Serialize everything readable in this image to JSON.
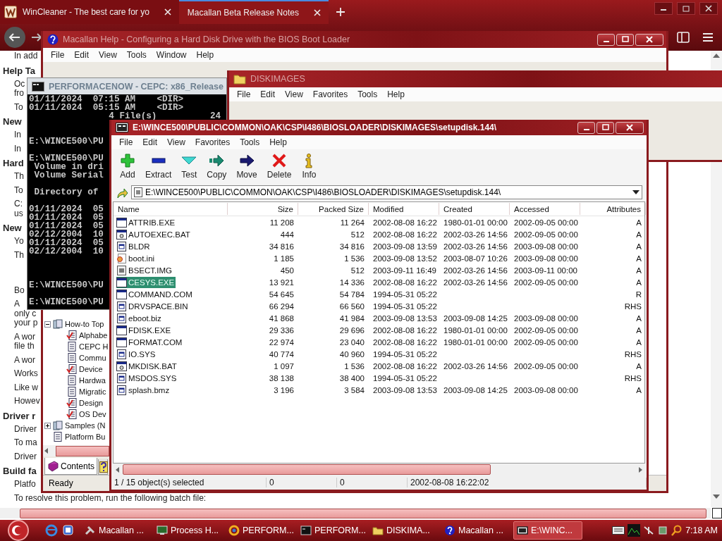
{
  "browser": {
    "tabs": [
      {
        "title": "WinCleaner - The best care for yo",
        "selected": false
      },
      {
        "title": "Macallan Beta Release Notes",
        "selected": true
      }
    ],
    "article_top": [
      {
        "kind": "para",
        "lines": [
          "In add"
        ]
      },
      {
        "kind": "heading",
        "lines": [
          "Help Ta"
        ]
      },
      {
        "kind": "para",
        "lines": [
          "Oc",
          "fro"
        ]
      },
      {
        "kind": "para",
        "lines": [
          "To"
        ]
      },
      {
        "kind": "heading",
        "lines": [
          "New"
        ]
      },
      {
        "kind": "para",
        "lines": [
          "In"
        ]
      },
      {
        "kind": "para",
        "lines": [
          "In"
        ]
      },
      {
        "kind": "heading",
        "lines": [
          "Hard"
        ]
      },
      {
        "kind": "para",
        "lines": [
          "Th"
        ]
      },
      {
        "kind": "para",
        "lines": [
          "To"
        ]
      },
      {
        "kind": "para",
        "lines": [
          "C:",
          "us"
        ]
      },
      {
        "kind": "heading",
        "lines": [
          "New"
        ]
      },
      {
        "kind": "para",
        "lines": [
          "Yo"
        ]
      },
      {
        "kind": "para",
        "lines": [
          "Th"
        ]
      }
    ],
    "article_bottom": [
      {
        "kind": "para",
        "lines": [
          "Bo"
        ]
      },
      {
        "kind": "para",
        "lines": [
          "A",
          "only c",
          "your p"
        ]
      },
      {
        "kind": "para",
        "lines": [
          "A wor",
          "file th"
        ]
      },
      {
        "kind": "para",
        "lines": [
          "A wor"
        ]
      },
      {
        "kind": "para",
        "lines": [
          "Works"
        ]
      },
      {
        "kind": "para",
        "lines": [
          "Like w"
        ]
      },
      {
        "kind": "para",
        "lines": [
          "Howev"
        ]
      },
      {
        "kind": "heading",
        "lines": [
          "Driver r"
        ]
      },
      {
        "kind": "para",
        "lines": [
          "Driver"
        ]
      },
      {
        "kind": "para",
        "lines": [
          "To ma"
        ]
      },
      {
        "kind": "para",
        "lines": [
          "Driver"
        ]
      },
      {
        "kind": "heading",
        "lines": [
          "Build fa"
        ]
      },
      {
        "kind": "para",
        "lines": [
          "Platfo"
        ]
      },
      {
        "kind": "para",
        "lines": [
          "To resolve this problem, run the following batch file:"
        ]
      }
    ]
  },
  "help_window": {
    "title": "Macallan Help - Configuring a Hard Disk Drive with the BIOS Boot Loader",
    "menu": [
      "File",
      "Edit",
      "View",
      "Tools",
      "Window",
      "Help"
    ],
    "tree": [
      {
        "label": "How-to Top",
        "kind": "book",
        "expanded": true,
        "children": [
          {
            "label": "Alphabe",
            "kind": "checklist"
          },
          {
            "label": "CEPC H",
            "kind": "page"
          },
          {
            "label": "Commu",
            "kind": "page"
          },
          {
            "label": "Device",
            "kind": "checklist"
          },
          {
            "label": "Hardwa",
            "kind": "page"
          },
          {
            "label": "Migratic",
            "kind": "page"
          },
          {
            "label": "Design",
            "kind": "checklist"
          },
          {
            "label": "OS Dev",
            "kind": "checklist"
          }
        ]
      },
      {
        "label": "Samples (N",
        "kind": "book",
        "expanded": false
      },
      {
        "label": "Platform Bu",
        "kind": "page"
      }
    ],
    "tabs": [
      {
        "kind": "contents",
        "label": "Contents",
        "selected": true
      },
      {
        "kind": "index",
        "selected": false
      }
    ],
    "status": "Ready"
  },
  "explorer_window": {
    "title": "DISKIMAGES",
    "menu": [
      "File",
      "Edit",
      "View",
      "Favorites",
      "Tools",
      "Help"
    ]
  },
  "console_window": {
    "title": "PERFORMACENOW - CEPC: x86_Release",
    "output": "01/11/2024  07:15 AM    <DIR>\n01/11/2024  05:15 AM    <DIR>\n               4 File(s)          24\n\n\nE:\\WINCE500\\PU\n\nE:\\WINCE500\\PU\n Volume in dri\n Volume Serial\n\n Directory of\n\n01/11/2024  05\n01/11/2024  05\n01/11/2024  05\n02/12/2004  10\n01/11/2024  05\n02/12/2004  10\n\n\n\nE:\\WINCE500\\PU\n\nE:\\WINCE500\\PU"
  },
  "archive_window": {
    "title": "E:\\WINCE500\\PUBLIC\\COMMON\\OAK\\CSP\\I486\\BIOSLOADER\\DISKIMAGES\\setupdisk.144\\",
    "menu": [
      "File",
      "Edit",
      "View",
      "Favorites",
      "Tools",
      "Help"
    ],
    "toolbar": [
      {
        "label": "Add",
        "kind": "add"
      },
      {
        "label": "Extract",
        "kind": "extract"
      },
      {
        "label": "Test",
        "kind": "test"
      },
      {
        "label": "Copy",
        "kind": "copy"
      },
      {
        "label": "Move",
        "kind": "move"
      },
      {
        "label": "Delete",
        "kind": "delete"
      },
      {
        "label": "Info",
        "kind": "info"
      }
    ],
    "path": "E:\\WINCE500\\PUBLIC\\COMMON\\OAK\\CSP\\I486\\BIOSLOADER\\DISKIMAGES\\setupdisk.144\\",
    "columns": [
      "Name",
      "Size",
      "Packed Size",
      "Modified",
      "Created",
      "Accessed",
      "Attributes"
    ],
    "files": [
      {
        "name": "ATTRIB.EXE",
        "kind": "exe",
        "size": "11 208",
        "packed_size": "11 264",
        "modified": "2002-08-08 16:22",
        "created": "1980-01-01 00:00",
        "accessed": "2002-09-05 00:00",
        "attributes": "A",
        "selected": false
      },
      {
        "name": "AUTOEXEC.BAT",
        "kind": "bat",
        "size": "444",
        "packed_size": "512",
        "modified": "2002-08-08 16:22",
        "created": "2002-03-26 14:56",
        "accessed": "2002-09-05 00:00",
        "attributes": "A",
        "selected": false
      },
      {
        "name": "BLDR",
        "kind": "bin",
        "size": "34 816",
        "packed_size": "34 816",
        "modified": "2003-09-08 13:59",
        "created": "2002-03-26 14:56",
        "accessed": "2003-09-08 00:00",
        "attributes": "A",
        "selected": false
      },
      {
        "name": "boot.ini",
        "kind": "ini",
        "size": "1 185",
        "packed_size": "1 536",
        "modified": "2003-09-08 13:52",
        "created": "2003-08-07 10:26",
        "accessed": "2003-09-08 00:00",
        "attributes": "A",
        "selected": false
      },
      {
        "name": "BSECT.IMG",
        "kind": "img",
        "size": "450",
        "packed_size": "512",
        "modified": "2003-09-11 16:49",
        "created": "2002-03-26 14:56",
        "accessed": "2003-09-11 00:00",
        "attributes": "A",
        "selected": false
      },
      {
        "name": "CESYS.EXE",
        "kind": "exe",
        "size": "13 921",
        "packed_size": "14 336",
        "modified": "2002-08-08 16:22",
        "created": "2002-03-26 14:56",
        "accessed": "2002-09-05 00:00",
        "attributes": "A",
        "selected": true
      },
      {
        "name": "COMMAND.COM",
        "kind": "exe",
        "size": "54 645",
        "packed_size": "54 784",
        "modified": "1994-05-31 05:22",
        "attributes": "R",
        "selected": false
      },
      {
        "name": "DRVSPACE.BIN",
        "kind": "bin",
        "size": "66 294",
        "packed_size": "66 560",
        "modified": "1994-05-31 05:22",
        "attributes": "RHS",
        "selected": false
      },
      {
        "name": "eboot.biz",
        "kind": "bin",
        "size": "41 868",
        "packed_size": "41 984",
        "modified": "2003-09-08 13:53",
        "created": "2003-09-08 14:25",
        "accessed": "2003-09-08 00:00",
        "attributes": "A",
        "selected": false
      },
      {
        "name": "FDISK.EXE",
        "kind": "exe",
        "size": "29 336",
        "packed_size": "29 696",
        "modified": "2002-08-08 16:22",
        "created": "1980-01-01 00:00",
        "accessed": "2002-09-05 00:00",
        "attributes": "A",
        "selected": false
      },
      {
        "name": "FORMAT.COM",
        "kind": "exe",
        "size": "22 974",
        "packed_size": "23 040",
        "modified": "2002-08-08 16:22",
        "created": "1980-01-01 00:00",
        "accessed": "2002-09-05 00:00",
        "attributes": "A",
        "selected": false
      },
      {
        "name": "IO.SYS",
        "kind": "bin",
        "size": "40 774",
        "packed_size": "40 960",
        "modified": "1994-05-31 05:22",
        "attributes": "RHS",
        "selected": false
      },
      {
        "name": "MKDISK.BAT",
        "kind": "bat",
        "size": "1 097",
        "packed_size": "1 536",
        "modified": "2002-08-08 16:22",
        "created": "2002-03-26 14:56",
        "accessed": "2002-09-05 00:00",
        "attributes": "A",
        "selected": false
      },
      {
        "name": "MSDOS.SYS",
        "kind": "bin",
        "size": "38 138",
        "packed_size": "38 400",
        "modified": "1994-05-31 05:22",
        "attributes": "RHS",
        "selected": false
      },
      {
        "name": "splash.bmz",
        "kind": "bin",
        "size": "3 196",
        "packed_size": "3 584",
        "modified": "2003-09-08 13:53",
        "created": "2003-09-08 14:25",
        "accessed": "2003-09-08 00:00",
        "attributes": "A",
        "selected": false
      }
    ],
    "status": {
      "selection": "1 / 15 object(s) selected",
      "size": "0",
      "packed_size": "0",
      "modified": "2002-08-08 16:22:02"
    }
  },
  "taskbar": {
    "items": [
      {
        "label": "Macallan ...",
        "kind": "tool",
        "selected": false
      },
      {
        "label": "Process H...",
        "kind": "monitor",
        "selected": false
      },
      {
        "label": "PERFORM...",
        "kind": "ring",
        "selected": false
      },
      {
        "label": "PERFORM...",
        "kind": "console",
        "selected": false
      },
      {
        "label": "DISKIMA...",
        "kind": "folder",
        "selected": false
      },
      {
        "label": "Macallan ...",
        "kind": "help",
        "selected": false
      },
      {
        "label": "E:\\WINC...",
        "kind": "archive",
        "selected": true
      }
    ],
    "clock": "7:18 AM"
  }
}
